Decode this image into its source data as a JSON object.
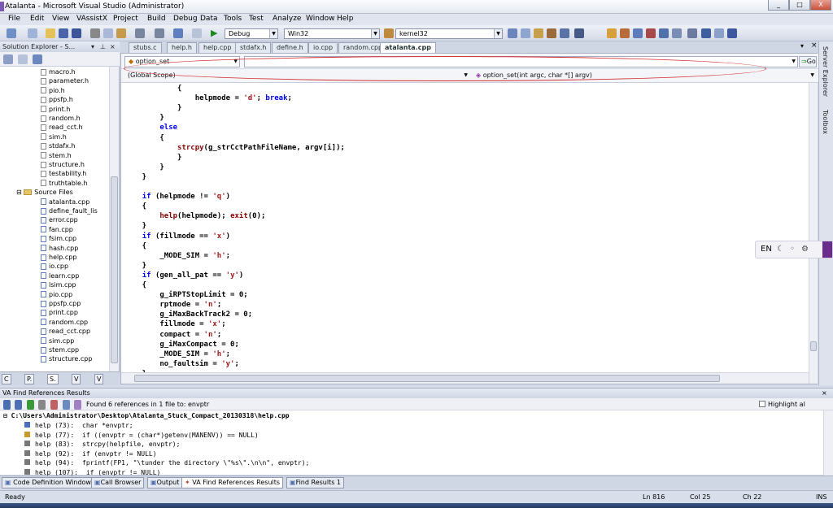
{
  "window": {
    "title": "Atalanta - Microsoft Visual Studio (Administrator)",
    "controls": [
      "_",
      "□",
      "X"
    ]
  },
  "menu": [
    "File",
    "Edit",
    "View",
    "VAssistX",
    "Project",
    "Build",
    "Debug",
    "Data",
    "Tools",
    "Test",
    "Analyze",
    "Window",
    "Help"
  ],
  "toolbar": {
    "config": "Debug",
    "platform": "Win32",
    "find_text": "kernel32"
  },
  "solution_explorer": {
    "title": "Solution Explorer - S...",
    "headers": [
      "macro.h",
      "parameter.h",
      "pio.h",
      "ppsfp.h",
      "print.h",
      "random.h",
      "read_cct.h",
      "sim.h",
      "stdafx.h",
      "stem.h",
      "structure.h",
      "testability.h",
      "truthtable.h"
    ],
    "source_folder": "Source Files",
    "sources": [
      "atalanta.cpp",
      "define_fault_lis",
      "error.cpp",
      "fan.cpp",
      "fsim.cpp",
      "hash.cpp",
      "help.cpp",
      "io.cpp",
      "learn.cpp",
      "lsim.cpp",
      "pio.cpp",
      "ppsfp.cpp",
      "print.cpp",
      "random.cpp",
      "read_cct.cpp",
      "sim.cpp",
      "stem.cpp",
      "structure.cpp"
    ],
    "tabs": [
      "C",
      "P.",
      "S.",
      "V",
      "V"
    ]
  },
  "doc_tabs": [
    "stubs.c",
    "help.h",
    "help.cpp",
    "stdafx.h",
    "define.h",
    "io.cpp",
    "random.cpp",
    "atalanta.cpp"
  ],
  "nav": {
    "symbol": "option_set",
    "scope": "(Global Scope)",
    "function": "option_set(int argc, char *[] argv)",
    "go": "Go"
  },
  "code_lines": [
    [
      {
        "t": "            {"
      }
    ],
    [
      {
        "t": "                helpmode = "
      },
      {
        "t": "'d'",
        "c": "st"
      },
      {
        "t": "; "
      },
      {
        "t": "break",
        "c": "kw"
      },
      {
        "t": ";"
      }
    ],
    [
      {
        "t": "            }"
      }
    ],
    [
      {
        "t": "        }"
      }
    ],
    [
      {
        "t": "        "
      },
      {
        "t": "else",
        "c": "kw"
      }
    ],
    [
      {
        "t": "        {"
      }
    ],
    [
      {
        "t": "            "
      },
      {
        "t": "strcpy",
        "c": "fn"
      },
      {
        "t": "(g_strCctPathFileName, argv[i]);"
      }
    ],
    [
      {
        "t": "            }"
      }
    ],
    [
      {
        "t": "        }"
      }
    ],
    [
      {
        "t": "    }"
      }
    ],
    [
      {
        "t": ""
      }
    ],
    [
      {
        "t": "    "
      },
      {
        "t": "if",
        "c": "kw"
      },
      {
        "t": " (helpmode != "
      },
      {
        "t": "'q'",
        "c": "st"
      },
      {
        "t": ")"
      }
    ],
    [
      {
        "t": "    {"
      }
    ],
    [
      {
        "t": "        "
      },
      {
        "t": "help",
        "c": "fn"
      },
      {
        "t": "(helpmode); "
      },
      {
        "t": "exit",
        "c": "fn"
      },
      {
        "t": "(0);"
      }
    ],
    [
      {
        "t": "    }"
      }
    ],
    [
      {
        "t": "    "
      },
      {
        "t": "if",
        "c": "kw"
      },
      {
        "t": " (fillmode == "
      },
      {
        "t": "'x'",
        "c": "st"
      },
      {
        "t": ")"
      }
    ],
    [
      {
        "t": "    {"
      }
    ],
    [
      {
        "t": "        _MODE_SIM = "
      },
      {
        "t": "'h'",
        "c": "st"
      },
      {
        "t": ";"
      }
    ],
    [
      {
        "t": "    }"
      }
    ],
    [
      {
        "t": "    "
      },
      {
        "t": "if",
        "c": "kw"
      },
      {
        "t": " (gen_all_pat == "
      },
      {
        "t": "'y'",
        "c": "st"
      },
      {
        "t": ")"
      }
    ],
    [
      {
        "t": "    {"
      }
    ],
    [
      {
        "t": "        g_iRPTStopLimit = 0;"
      }
    ],
    [
      {
        "t": "        rptmode = "
      },
      {
        "t": "'n'",
        "c": "st"
      },
      {
        "t": ";"
      }
    ],
    [
      {
        "t": "        g_iMaxBackTrack2 = 0;"
      }
    ],
    [
      {
        "t": "        fillmode = "
      },
      {
        "t": "'x'",
        "c": "st"
      },
      {
        "t": ";"
      }
    ],
    [
      {
        "t": "        compact = "
      },
      {
        "t": "'n'",
        "c": "st"
      },
      {
        "t": ";"
      }
    ],
    [
      {
        "t": "        g_iMaxCompact = 0;"
      }
    ],
    [
      {
        "t": "        _MODE_SIM = "
      },
      {
        "t": "'h'",
        "c": "st"
      },
      {
        "t": ";"
      }
    ],
    [
      {
        "t": "        no_faultsim = "
      },
      {
        "t": "'y'",
        "c": "st"
      },
      {
        "t": ";"
      }
    ],
    [
      {
        "t": "    }"
      }
    ]
  ],
  "right_strip": [
    "Server Explorer",
    "Toolbox"
  ],
  "ime": {
    "lang": "EN"
  },
  "find_refs": {
    "title": "VA Find References Results",
    "summary": "Found 6 references in 1 file to: envptr",
    "highlight": "Highlight al",
    "file": "C:\\Users\\Administrator\\Desktop\\Atalanta_Stuck_Compact_20130318\\help.cpp",
    "results": [
      {
        "loc": "help (73):",
        "code": "char *envptr;"
      },
      {
        "loc": "help (77):",
        "code": "if ((envptr = (char*)getenv(MANENV)) == NULL)"
      },
      {
        "loc": "help (83):",
        "code": "strcpy(helpfile, envptr);"
      },
      {
        "loc": "help (92):",
        "code": "if (envptr != NULL)"
      },
      {
        "loc": "help (94):",
        "code": "fprintf(FP1, \"\\tunder the directory \\\"%s\\\".\\n\\n\", envptr);"
      },
      {
        "loc": "help (107):",
        "code": " if (envptr != NULL)"
      }
    ]
  },
  "bottom_tabs": [
    "Code Definition Window",
    "Call Browser",
    "Output",
    "VA Find References Results",
    "Find Results 1"
  ],
  "status": {
    "left": "Ready",
    "ln": "Ln 816",
    "col": "Col 25",
    "ch": "Ch 22",
    "mode": "INS"
  }
}
